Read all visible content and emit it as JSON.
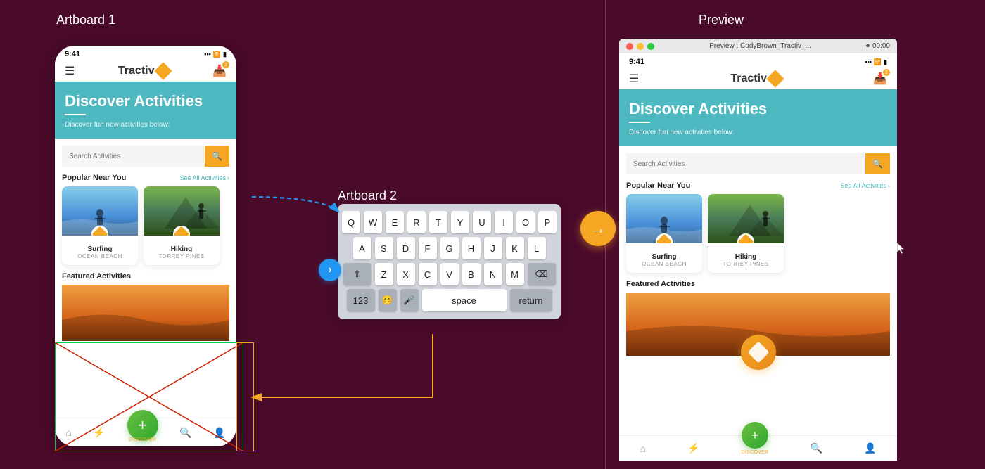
{
  "artboard1": {
    "label": "Artboard 1",
    "phone": {
      "status_time": "9:41",
      "nav_logo": "Tractiv",
      "hero_title": "Discover Activities",
      "hero_subtitle": "Discover fun new activities below:",
      "search_placeholder": "Search Activities",
      "popular_title": "Popular Near You",
      "see_all": "See All Activities",
      "activities": [
        {
          "name": "Surfing",
          "location": "OCEAN BEACH"
        },
        {
          "name": "Hiking",
          "location": "TORREY PINES"
        }
      ],
      "featured_title": "Featured Activities",
      "bottom_nav": [
        "home",
        "activity",
        "discover",
        "profile"
      ],
      "discover_label": "DISCOVER"
    }
  },
  "artboard2": {
    "label": "Artboard 2",
    "keyboard": {
      "rows": [
        [
          "Q",
          "W",
          "E",
          "R",
          "T",
          "Y",
          "U",
          "I",
          "O",
          "P"
        ],
        [
          "A",
          "S",
          "D",
          "F",
          "G",
          "H",
          "J",
          "K",
          "L"
        ],
        [
          "⇧",
          "Z",
          "X",
          "C",
          "V",
          "B",
          "N",
          "M",
          "⌫"
        ],
        [
          "123",
          "😊",
          "🎤",
          "space",
          "return"
        ]
      ]
    }
  },
  "preview": {
    "label": "Preview",
    "titlebar": "Preview : CodyBrown_Tractiv_...",
    "time": "00:00",
    "phone": {
      "status_time": "9:41",
      "nav_logo": "Tractiv",
      "hero_title": "Discover Activities",
      "hero_subtitle": "Discover fun new activities below:",
      "search_placeholder": "Search Activities",
      "popular_title": "Popular Near You",
      "see_all": "See All Activities",
      "activities": [
        {
          "name": "Surfing",
          "location": "OCEAN BEACH"
        },
        {
          "name": "Hiking",
          "location": "TORREY PINES"
        }
      ],
      "featured_title": "Featured Activities",
      "discover_label": "DISCOVER"
    }
  },
  "colors": {
    "teal": "#4db8c0",
    "orange": "#f5a623",
    "green": "#2ea82e",
    "background": "#5c0d35",
    "dark_bg": "#4a0a2a"
  },
  "icons": {
    "menu": "☰",
    "inbox": "📥",
    "home": "⌂",
    "activity": "⚡",
    "discover": "◈",
    "profile": "👤",
    "search": "🔍",
    "arrow_right": "→",
    "chevron_right": "›",
    "arrow_back": "⌫",
    "shift": "⇧"
  }
}
